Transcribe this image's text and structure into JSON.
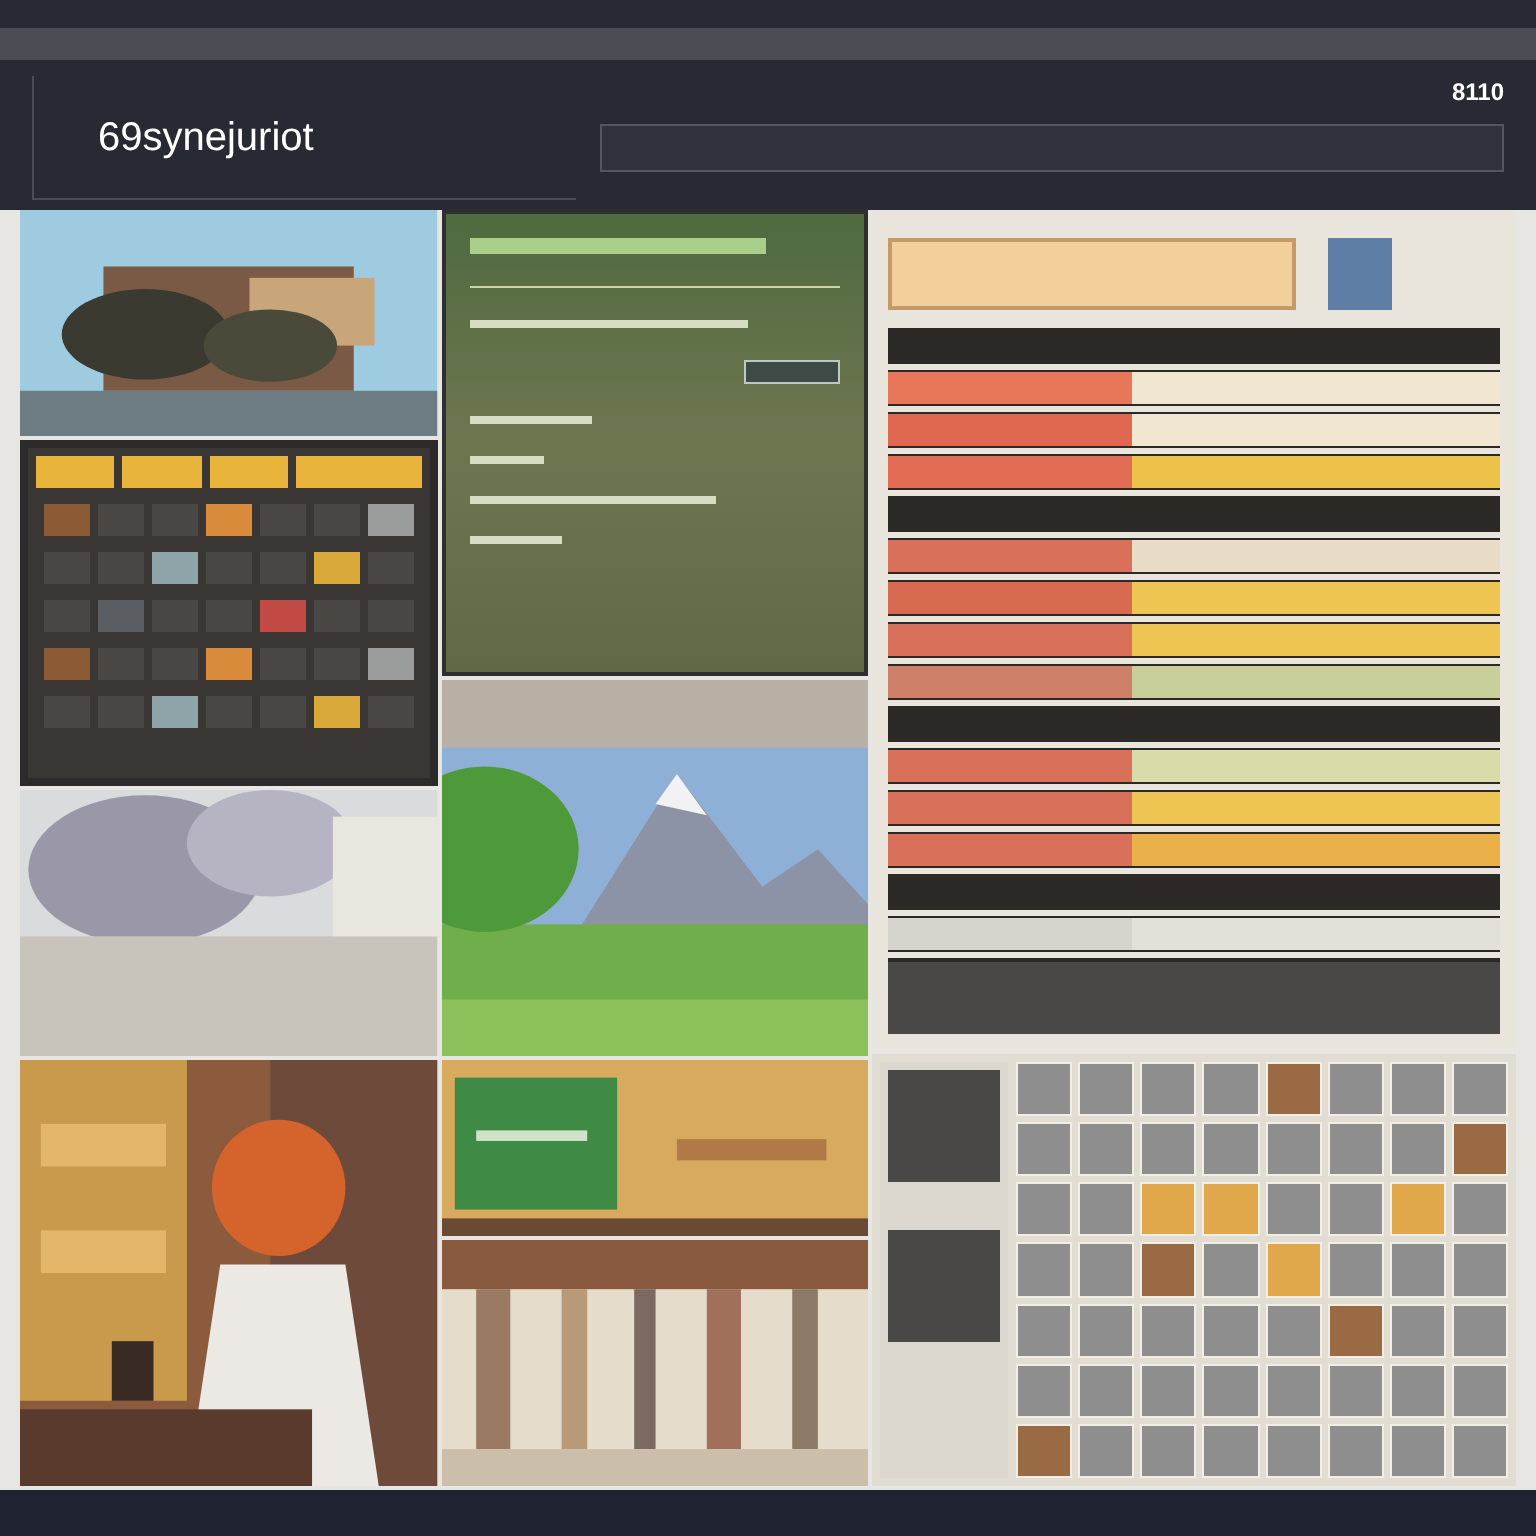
{
  "window": {
    "title": "69synejuriot",
    "counter": "8110"
  },
  "columns": [
    {
      "tiles": [
        {
          "kind": "picture"
        },
        {
          "kind": "table"
        },
        {
          "kind": "picture"
        },
        {
          "kind": "picture"
        }
      ]
    },
    {
      "tiles": [
        {
          "kind": "form"
        },
        {
          "kind": "picture"
        },
        {
          "kind": "picture"
        },
        {
          "kind": "picture"
        }
      ]
    },
    {
      "tiles": [
        {
          "kind": "bars"
        },
        {
          "kind": "grid"
        }
      ]
    }
  ]
}
